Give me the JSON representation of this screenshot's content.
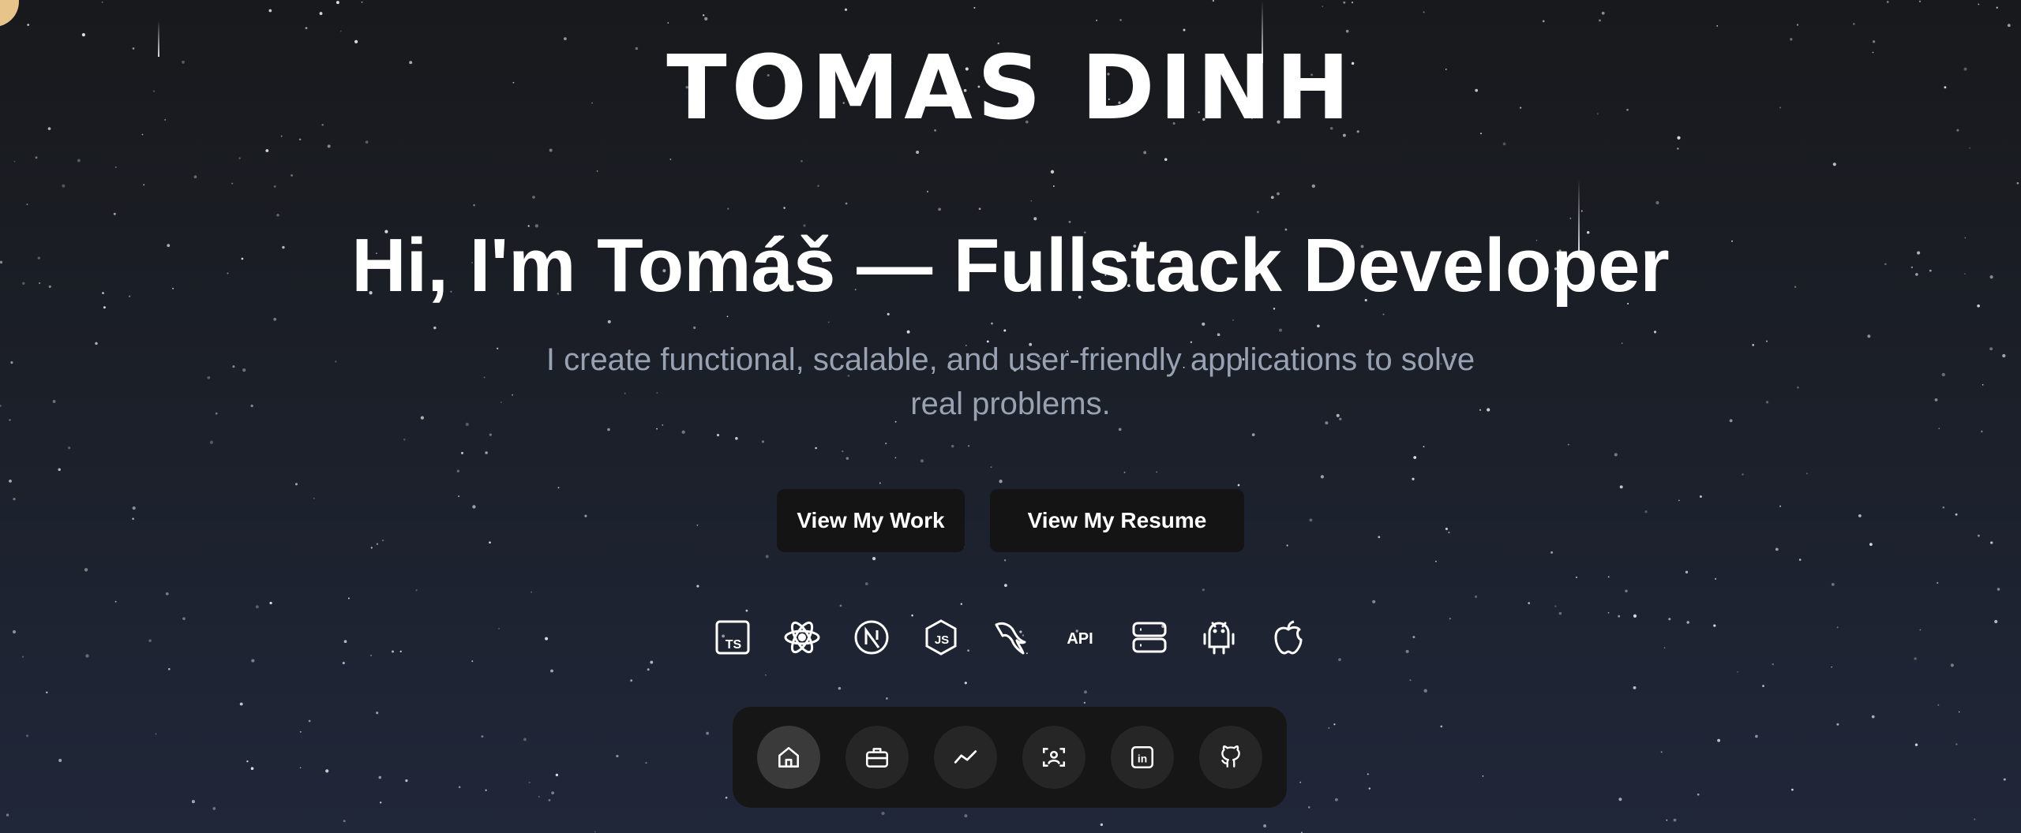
{
  "logo": {
    "text": "TOMAS DINH"
  },
  "hero": {
    "headline": "Hi, I'm Tomáš — Fullstack Developer",
    "subtitle": "I create functional, scalable, and user-friendly applications to solve real problems."
  },
  "cta": {
    "work_label": "View My Work",
    "resume_label": "View My Resume"
  },
  "tech_stack": {
    "items": [
      "typescript-icon",
      "react-icon",
      "nextjs-icon",
      "nodejs-icon",
      "mysql-icon",
      "api-icon",
      "server-icon",
      "android-icon",
      "apple-icon"
    ],
    "api_label": "API",
    "ts_label": "TS",
    "js_label": "JS"
  },
  "dock": {
    "items": [
      "home-icon",
      "briefcase-icon",
      "chart-line-icon",
      "face-scan-icon",
      "linkedin-icon",
      "github-icon"
    ],
    "active": "home-icon",
    "linkedin_label": "in"
  },
  "colors": {
    "background_top": "#18191c",
    "background_bottom": "#202739",
    "subtitle": "#98a2b3",
    "button": "#141414",
    "dock": "#161616",
    "moon": "#e7c58a"
  }
}
